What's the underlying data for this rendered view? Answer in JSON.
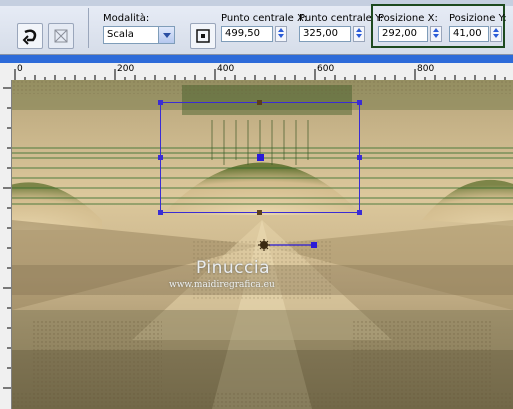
{
  "toolbar": {
    "mode_label": "Modalità:",
    "mode_value": "Scala",
    "center_x_label": "Punto centrale X:",
    "center_x_value": "499,50",
    "center_y_label": "Punto centrale Y:",
    "center_y_value": "325,00",
    "pos_x_label": "Posizione X:",
    "pos_x_value": "292,00",
    "pos_y_label": "Posizione Y:",
    "pos_y_value": "41,00"
  },
  "ruler": {
    "ticks": [
      "0",
      "200",
      "400",
      "600",
      "800"
    ]
  },
  "watermark": {
    "name": "Pinuccia",
    "url": "www.maidiregrafica.eu"
  },
  "colors": {
    "accent_blue": "#2d6bd9",
    "selection": "#3a2cd4",
    "highlight_box": "#1d4a1f"
  }
}
